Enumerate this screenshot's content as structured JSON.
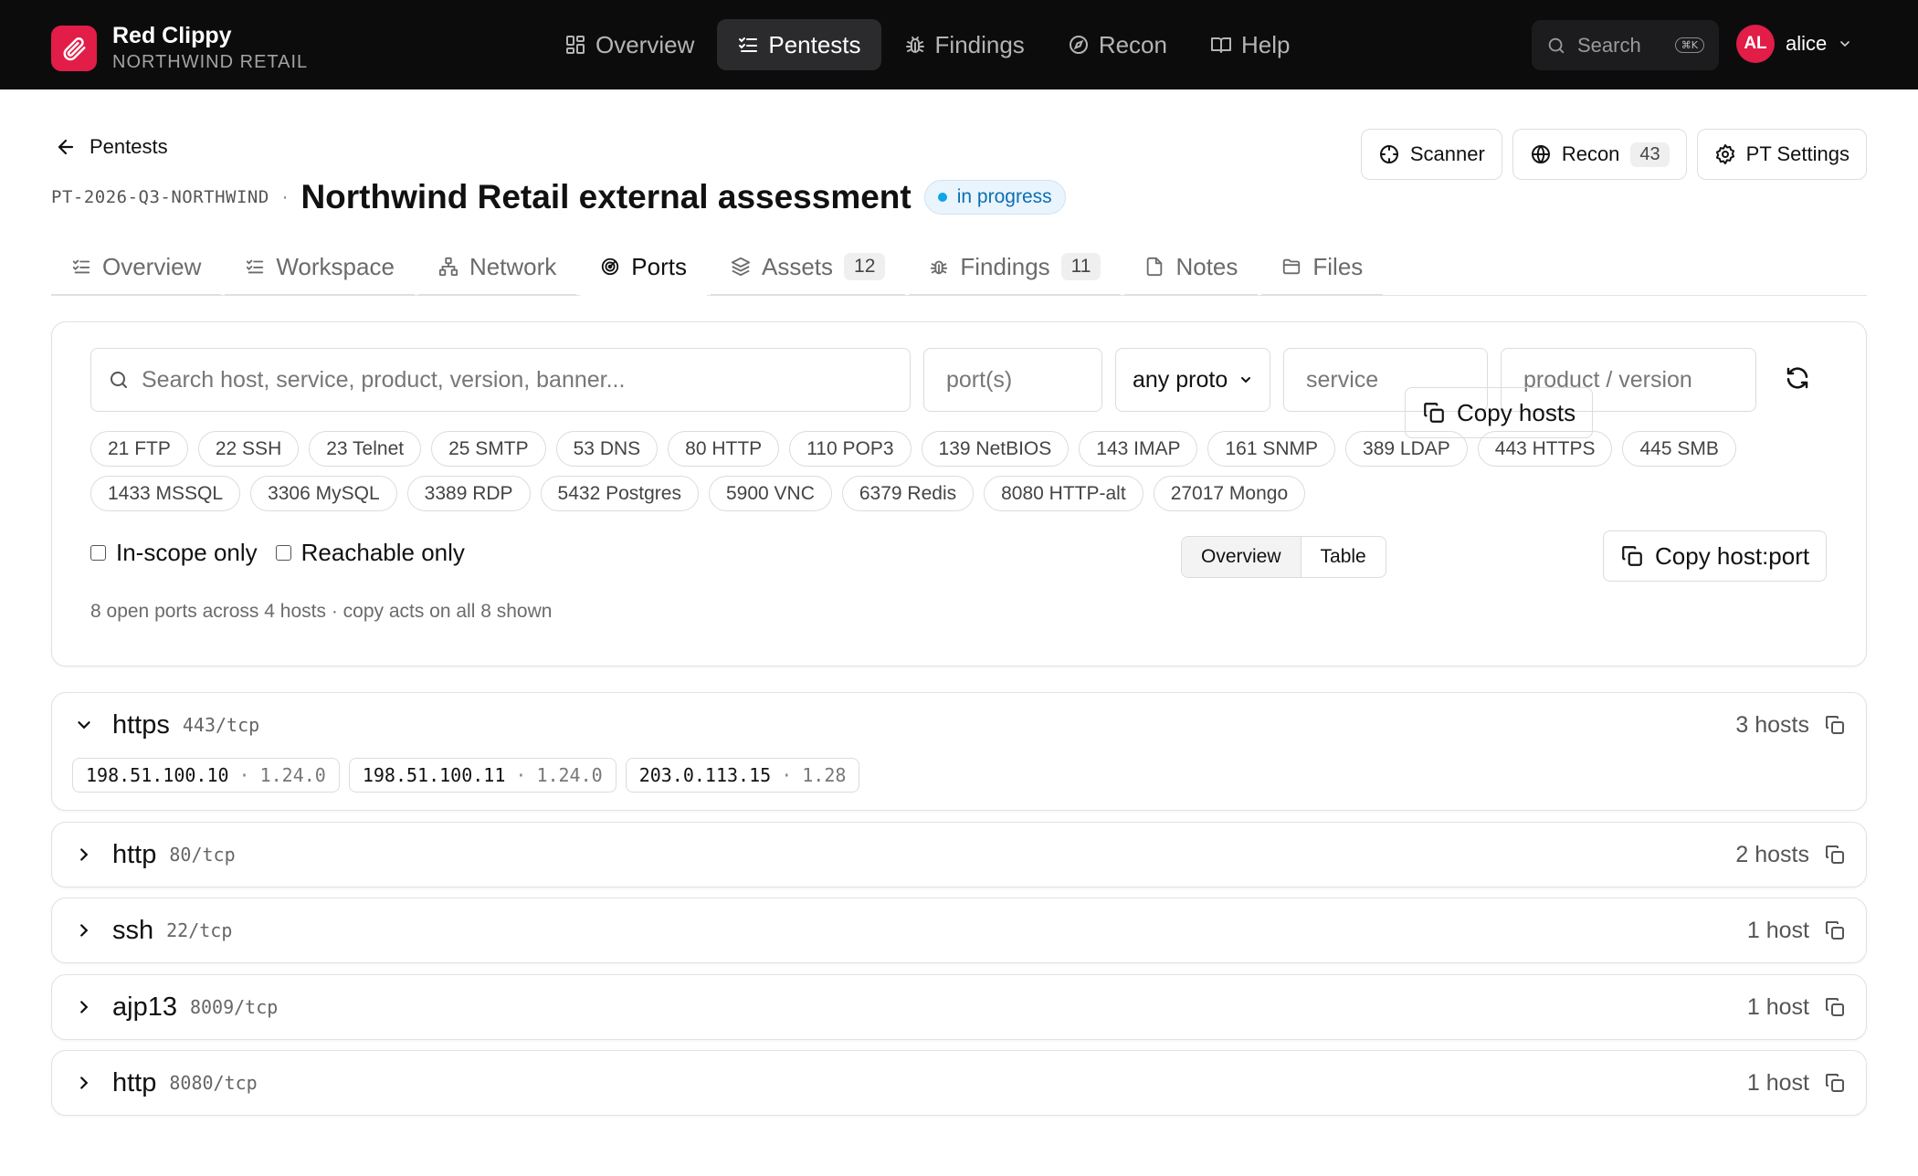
{
  "app": {
    "name": "Red Clippy",
    "org": "NORTHWIND RETAIL"
  },
  "nav": {
    "items": [
      {
        "label": "Overview",
        "icon": "dashboard-icon"
      },
      {
        "label": "Pentests",
        "icon": "checklist-icon"
      },
      {
        "label": "Findings",
        "icon": "bug-icon"
      },
      {
        "label": "Recon",
        "icon": "compass-icon"
      },
      {
        "label": "Help",
        "icon": "book-icon"
      }
    ],
    "active": "Pentests"
  },
  "search": {
    "label": "Search",
    "shortcut": "⌘K"
  },
  "user": {
    "initials": "AL",
    "name": "alice"
  },
  "breadcrumb": {
    "back_label": "Pentests"
  },
  "pentest": {
    "code": "PT-2026-Q3-NORTHWIND",
    "separator": "·",
    "title": "Northwind Retail external assessment",
    "status": "in progress"
  },
  "header_actions": {
    "scanner": "Scanner",
    "recon": "Recon",
    "recon_count": "43",
    "settings": "PT Settings"
  },
  "tabs": {
    "overview": "Overview",
    "workspace": "Workspace",
    "network": "Network",
    "ports": "Ports",
    "assets": "Assets",
    "assets_count": "12",
    "findings": "Findings",
    "findings_count": "11",
    "notes": "Notes",
    "files": "Files",
    "active": "Ports"
  },
  "filters": {
    "search_placeholder": "Search host, service, product, version, banner...",
    "port_placeholder": "port(s)",
    "proto_value": "any proto",
    "service_placeholder": "service",
    "product_placeholder": "product / version",
    "quick_ports_row1": [
      "21 FTP",
      "22 SSH",
      "23 Telnet",
      "25 SMTP",
      "53 DNS",
      "80 HTTP",
      "110 POP3",
      "139 NetBIOS",
      "143 IMAP",
      "161 SNMP",
      "389 LDAP",
      "443 HTTPS",
      "445 SMB"
    ],
    "quick_ports_row2": [
      "1433 MSSQL",
      "3306 MySQL",
      "3389 RDP",
      "5432 Postgres",
      "5900 VNC",
      "6379 Redis",
      "8080 HTTP-alt",
      "27017 Mongo"
    ],
    "in_scope_label": "In-scope only",
    "reachable_label": "Reachable only",
    "view_overview": "Overview",
    "view_table": "Table",
    "view_active": "Overview",
    "copy_hosts": "Copy hosts",
    "copy_hostport": "Copy host:port",
    "summary": "8 open ports across 4 hosts · copy acts on all 8 shown"
  },
  "groups": [
    {
      "service": "https",
      "port": "443/tcp",
      "count": "3 hosts",
      "expanded": true,
      "hosts": [
        {
          "ip": "198.51.100.10",
          "version": "1.24.0"
        },
        {
          "ip": "198.51.100.11",
          "version": "1.24.0"
        },
        {
          "ip": "203.0.113.15",
          "version": "1.28"
        }
      ]
    },
    {
      "service": "http",
      "port": "80/tcp",
      "count": "2 hosts",
      "expanded": false
    },
    {
      "service": "ssh",
      "port": "22/tcp",
      "count": "1 host",
      "expanded": false
    },
    {
      "service": "ajp13",
      "port": "8009/tcp",
      "count": "1 host",
      "expanded": false
    },
    {
      "service": "http",
      "port": "8080/tcp",
      "count": "1 host",
      "expanded": false
    }
  ],
  "colors": {
    "brand": "#e11d48",
    "topbar": "#0c0c0d",
    "status_dot": "#0ea5e9"
  }
}
